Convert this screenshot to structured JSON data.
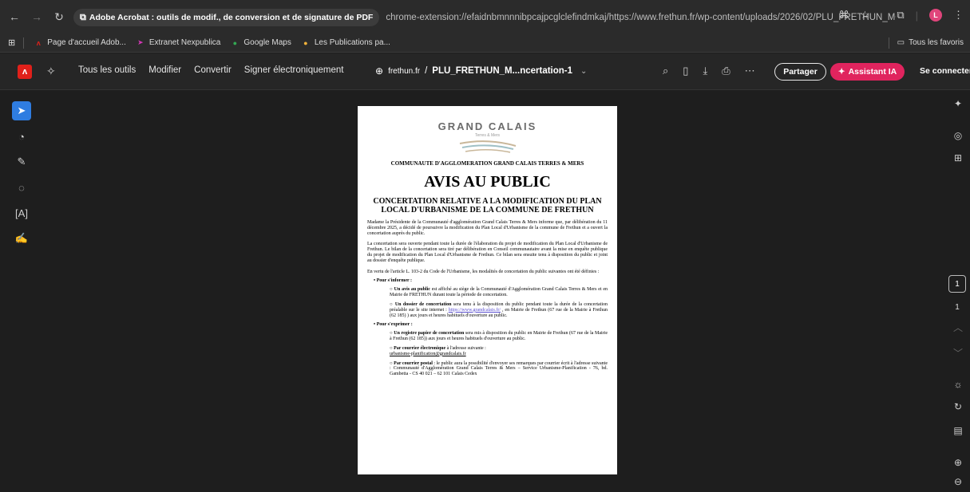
{
  "browser": {
    "tab_title": "Adobe Acrobat : outils de modif., de conversion et de signature de PDF",
    "url": "chrome-extension://efaidnbmnnnibpcajpcglclefindmkaj/https://www.frethun.fr/wp-content/uploads/2026/02/PLU_FRETHUN_MODIF_...",
    "profile_initial": "L",
    "bookmarks": [
      {
        "label": "Page d'accueil Adob..."
      },
      {
        "label": "Extranet Nexpublica"
      },
      {
        "label": "Google Maps"
      },
      {
        "label": "Les Publications pa..."
      }
    ],
    "all_favorites": "Tous les favoris"
  },
  "acrobat": {
    "menu": [
      "Tous les outils",
      "Modifier",
      "Convertir",
      "Signer électroniquement"
    ],
    "domain": "frethun.fr",
    "sep": "/",
    "filename": "PLU_FRETHUN_M...ncertation-1",
    "share_label": "Partager",
    "assistant_label": "Assistant IA",
    "connect_label": "Se connecter",
    "current_page": "1",
    "total_pages": "1",
    "accent": "#e0245e"
  },
  "document": {
    "logo_main": "GRAND CALAIS",
    "logo_sub": "Terres & Mers",
    "org": "COMMUNAUTE D'AGGLOMERATION GRAND CALAIS TERRES & MERS",
    "heading": "AVIS AU PUBLIC",
    "subtitle": "CONCERTATION RELATIVE A LA MODIFICATION DU PLAN LOCAL D'URBANISME DE LA COMMUNE DE FRETHUN",
    "p1": "Madame la Présidente de la Communauté d'agglomération Grand Calais Terres & Mers informe que, par délibération du 11 décembre 2025, a décidé de poursuivre la modification du Plan Local d'Urbanisme de la commune de Frethun et a ouvert la concertation auprès du public.",
    "p2": "La concertation sera ouverte pendant toute la durée de l'élaboration du projet de modification du Plan Local d'Urbanisme de Frethun. Le bilan de la concertation sera tiré par délibération en Conseil communautaire avant la mise en enquête publique du projet de modification du Plan Local d'Urbanisme de Frethun. Ce bilan sera ensuite tenu à disposition du public et joint au dossier d'enquête publique.",
    "p3": "En vertu de l'article L. 103-2 du Code de l'Urbanisme, les modalités de concertation du public suivantes ont été définies :",
    "s1_title": "Pour s'informer :",
    "s1_i1_bold": "Un avis au public",
    "s1_i1_text": " est affiché au siège de la Communauté d'Agglomération Grand Calais Terres & Mers et en Mairie de FRETHUN durant toute la période de concertation.",
    "s1_i2_bold": "Un dossier de concertation",
    "s1_i2_text": " sera tenu à la disposition du public pendant toute la durée de la concertation préalable sur le site internet : ",
    "s1_i2_link": "https://www.grandcalais.fr/",
    "s1_i2_tail": " , en Mairie de Frethun (67 rue de la Mairie à Frethun (62 185) ) aux jours et heures habituels d'ouverture au public.",
    "s2_title": "Pour s'exprimer :",
    "s2_i1_bold": "Un registre papier de concertation",
    "s2_i1_text": " sera mis à disposition du public en Mairie de Frethun (67 rue de la Mairie à Frethun (62 185)) aux jours et heures habituels d'ouverture au public.",
    "s2_i2_bold": "Par courrier électronique",
    "s2_i2_text": " à l'adresse suivante :",
    "s2_i2_email": "urbanisme-planification@grandcalais.fr",
    "s2_i3_bold": "Par courrier postal",
    "s2_i3_text": " : le public aura la possibilité d'envoyer ses remarques par courrier écrit à l'adresse suivante : Communauté d'Agglomération Grand Calais Terres & Mers – Service Urbanisme-Planification - 76, bd. Gambetta - CS 40 021 – 62 101 Calais Cedex"
  }
}
